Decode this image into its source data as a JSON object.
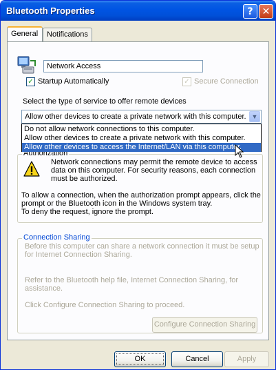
{
  "window": {
    "title": "Bluetooth Properties",
    "help_glyph": "?",
    "close_glyph": "✕"
  },
  "tabs": [
    {
      "label": "General"
    },
    {
      "label": "Notifications"
    }
  ],
  "general": {
    "service_name": "Network Access",
    "startup_checked": true,
    "startup_label": "Startup Automatically",
    "secure_checked": true,
    "secure_label": "Secure Connection",
    "select_label": "Select the type of service to offer remote devices",
    "combo_value": "Allow other devices to create a private network with this computer.",
    "dropdown_options": [
      "Do not allow network connections to this computer.",
      "Allow other devices to create a private network with this computer.",
      "Allow other devices to access the Internet/LAN via this computer."
    ],
    "dropdown_selected_index": 2
  },
  "authorization": {
    "legend": "Authorization",
    "lines": [
      "Network connections may permit the remote device to access",
      "data on this computer.  For security reasons, each connection",
      "must be authorized."
    ],
    "lines2": [
      "To allow a connection, when the authorization prompt appears, click the",
      "prompt or the Bluetooth icon in the Windows system tray.",
      "To deny the request, ignore the prompt."
    ]
  },
  "connection_sharing": {
    "legend": "Connection Sharing",
    "para1": [
      "Before this computer can share a network connection it must be setup",
      "for Internet Connection Sharing."
    ],
    "para2": [
      "Refer to the Bluetooth help file, Internet Connection Sharing, for",
      "assistance."
    ],
    "para3": "Click Configure Connection Sharing to proceed.",
    "configure_button": "Configure Connection Sharing"
  },
  "buttons": {
    "ok": "OK",
    "cancel": "Cancel",
    "apply": "Apply"
  },
  "icons": {
    "service_icon": "network-computer-icon",
    "warning_icon": "warning-icon",
    "cursor": "mouse-pointer-icon"
  }
}
